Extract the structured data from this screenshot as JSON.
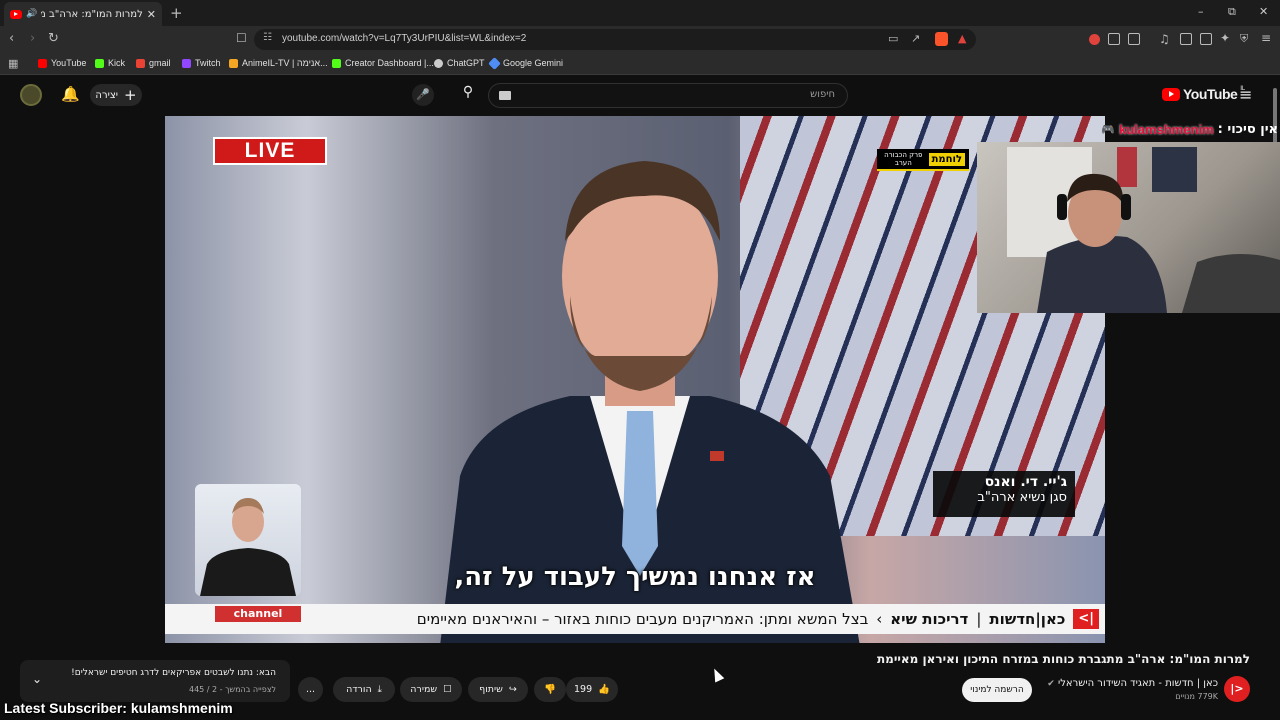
{
  "browser": {
    "tab_title": "למרות המו\"מ: ארה\"ב מתגברת כ",
    "new_tab": "+",
    "url": "youtube.com/watch?v=Lq7Ty3UrPIU&list=WL&index=2",
    "window_controls": {
      "minimize": "–",
      "maximize": "⧉",
      "close": "✕"
    },
    "bookmarks": [
      {
        "label": "YouTube",
        "color": "#ff0000"
      },
      {
        "label": "Kick",
        "color": "#53fc18"
      },
      {
        "label": "gmail",
        "color": "#ea4335"
      },
      {
        "label": "Twitch",
        "color": "#9146ff"
      },
      {
        "label": "AnimeIL-TV | אנימה...",
        "color": "#f5a623"
      },
      {
        "label": "Creator Dashboard |...",
        "color": "#53fc18"
      },
      {
        "label": "ChatGPT",
        "color": "#cccccc"
      },
      {
        "label": "Google Gemini",
        "color": "#4f8df5"
      }
    ]
  },
  "youtube": {
    "logo_text": "YouTube",
    "logo_sup": "IL",
    "search_placeholder": "חיפוש",
    "create_label": "יצירה"
  },
  "video": {
    "live_label": "LIVE",
    "war_badge_main": "לוחמת",
    "war_badge_sub": "פרק הכבורה הערב",
    "lower_third_name": "ג'יי. די. ואנס",
    "lower_third_title": "סגן נשיא ארה\"ב",
    "subtitle": "אז אנחנו נמשיך לעבוד על זה,",
    "ticker_logo": "|>",
    "ticker_brand": "כאן|חדשות",
    "ticker_sep": "|",
    "ticker_section": "דריכות שיא",
    "ticker_headline": "בצל המשא ומתן: האמריקנים מעבים כוחות באזור – והאיראנים מאיימים",
    "signer_channel": "channel"
  },
  "overlay": {
    "streamer_prefix": "אין סיכוי :",
    "streamer_name": "kulamshmenim",
    "latest_subscriber": "Latest Subscriber: kulamshmenim"
  },
  "below_video": {
    "title": "למרות המו\"מ: ארה\"ב מתגברת כוחות במזרח התיכון ואיראן מאיימת",
    "channel_name": "כאן | חדשות - תאגיד השידור הישראלי",
    "subscribers": "779K מנויים",
    "subscribe_label": "הרשמה למינוי",
    "like_count": "199",
    "share_label": "שיתוף",
    "save_label": "שמירה",
    "download_label": "הורדה",
    "more_label": "...",
    "next_title": "הבא: נתנו לשבטים אפריקאים לדרג חטיפים ישראלים!",
    "next_sub": "לצפייה בהמשך - 2 / 445"
  }
}
